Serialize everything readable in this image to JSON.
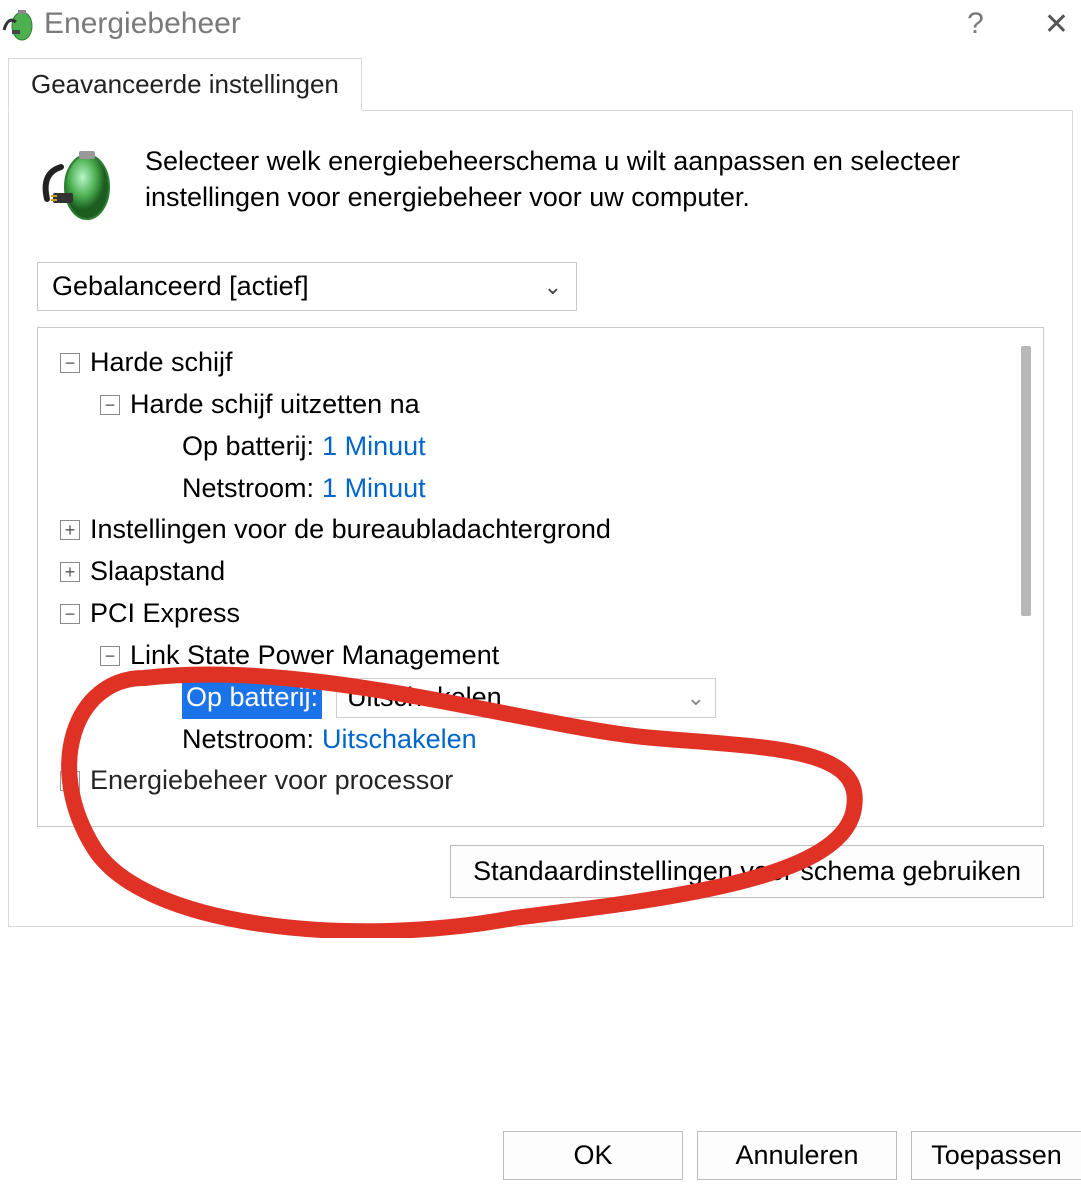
{
  "window": {
    "title": "Energiebeheer",
    "help_aria": "Help",
    "close_aria": "Sluiten"
  },
  "tab": {
    "label": "Geavanceerde instellingen"
  },
  "intro": "Selecteer welk energiebeheerschema u wilt aanpassen en selecteer instellingen voor energiebeheer voor uw computer.",
  "scheme": {
    "selected": "Gebalanceerd [actief]"
  },
  "tree": {
    "hdd": {
      "label": "Harde schijf",
      "turnoff": {
        "label": "Harde schijf uitzetten na",
        "on_battery_label": "Op batterij:",
        "on_battery_value": "1 Minuut",
        "plugged_label": "Netstroom:",
        "plugged_value": "1 Minuut"
      }
    },
    "desktop_bg": "Instellingen voor de bureaubladachtergrond",
    "sleep": "Slaapstand",
    "pci": {
      "label": "PCI Express",
      "link_state": {
        "label": "Link State Power Management",
        "on_battery_label": "Op batterij:",
        "on_battery_value": "Uitschakelen",
        "plugged_label": "Netstroom:",
        "plugged_value": "Uitschakelen"
      }
    },
    "cpu": "Energiebeheer voor processor"
  },
  "defaults_button": "Standaardinstellingen voor schema gebruiken",
  "buttons": {
    "ok": "OK",
    "cancel": "Annuleren",
    "apply": "Toepassen"
  }
}
